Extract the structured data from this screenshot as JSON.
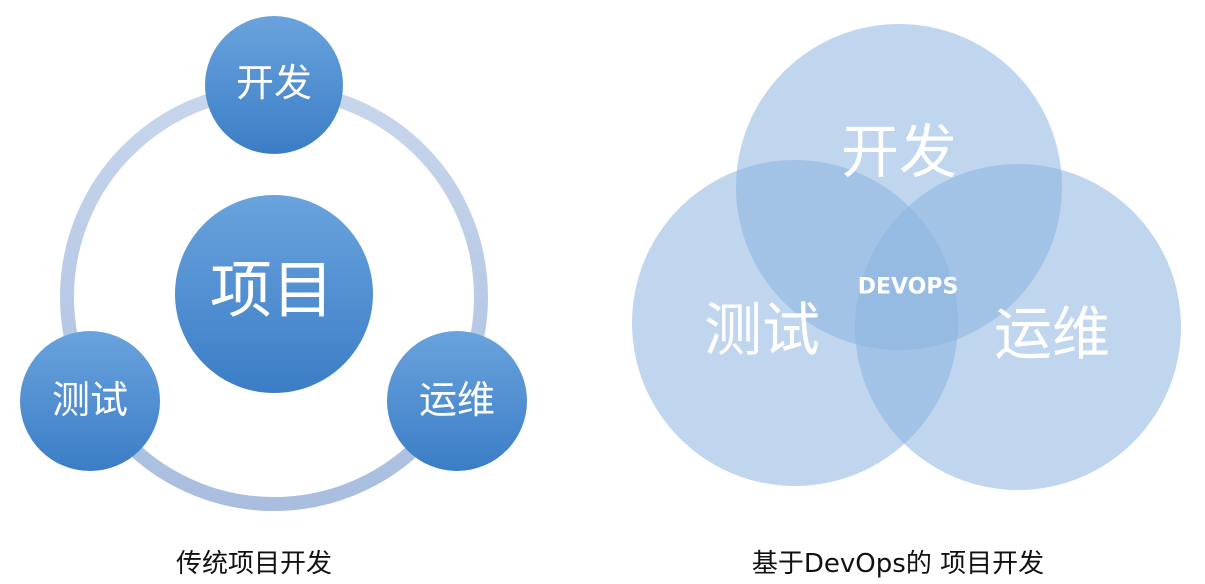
{
  "traditional": {
    "center_label": "项目",
    "top_label": "开发",
    "left_label": "测试",
    "right_label": "运维",
    "caption": "传统项目开发"
  },
  "devops": {
    "top_label": "开发",
    "left_label": "测试",
    "right_label": "运维",
    "center_label": "DEVOPS",
    "caption": "基于DevOps的 项目开发"
  },
  "colors": {
    "ring": "#b3c7e2",
    "node_light": "#6aa2dc",
    "node_dark": "#3c7fc7",
    "venn_fill": "#8fb8e2"
  }
}
